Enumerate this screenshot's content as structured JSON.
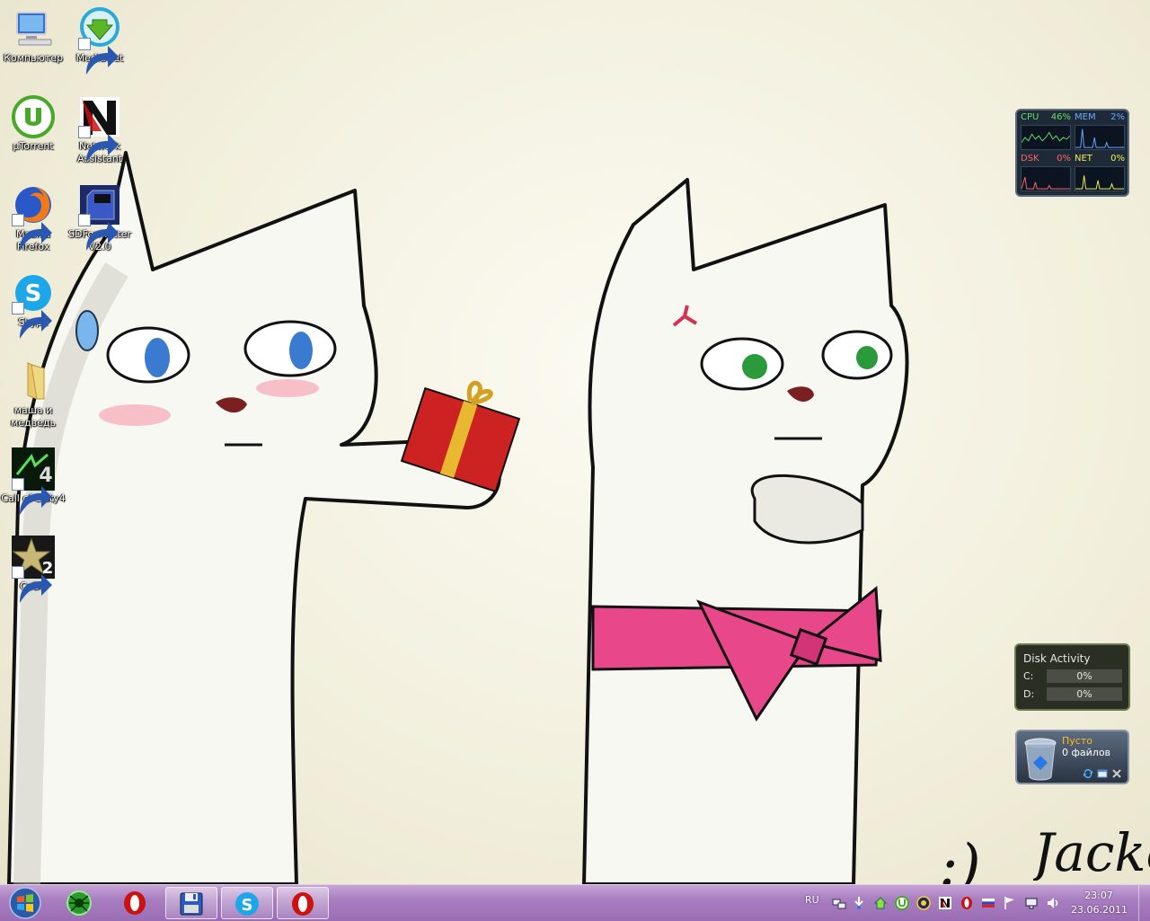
{
  "desktop": {
    "icons": [
      {
        "label": "Компьютер",
        "icon": "computer-icon"
      },
      {
        "label": "MediaGet",
        "icon": "mediaget-icon"
      },
      {
        "label": "µTorrent",
        "icon": "utorrent-icon"
      },
      {
        "label": "Network Assistant",
        "icon": "network-assistant-icon"
      },
      {
        "label": "Mozilla Firefox",
        "icon": "firefox-icon"
      },
      {
        "label": "SDFormatter V2.0",
        "icon": "sdformatter-icon"
      },
      {
        "label": "Skype",
        "icon": "skype-icon"
      },
      {
        "label": "маша и медведь",
        "icon": "folder-icon"
      },
      {
        "label": "Call of Duty4",
        "icon": "call-of-duty4-icon"
      },
      {
        "label": "CoD2",
        "icon": "cod2-icon"
      }
    ],
    "wallpaper_signature": "Jacke"
  },
  "cpu_meter": {
    "cpu": {
      "label": "CPU",
      "value": "46%",
      "color": "#66dd66"
    },
    "mem": {
      "label": "MEM",
      "value": "2%",
      "color": "#66aaff"
    },
    "dsk": {
      "label": "DSK",
      "value": "0%",
      "color": "#ff6666"
    },
    "net": {
      "label": "NET",
      "value": "0%",
      "color": "#eeee55"
    }
  },
  "disk_activity": {
    "title": "Disk Activity",
    "drives": [
      {
        "label": "C:",
        "value": "0%"
      },
      {
        "label": "D:",
        "value": "0%"
      }
    ]
  },
  "recycle_bin": {
    "status": "Пусто",
    "count": "0 файлов"
  },
  "taskbar": {
    "start_icon": "windows-start-icon",
    "buttons": [
      {
        "icon": "spider-app-icon"
      },
      {
        "icon": "opera-icon"
      },
      {
        "icon": "floppy-disk-icon"
      },
      {
        "icon": "skype-icon"
      },
      {
        "icon": "opera-icon"
      }
    ],
    "tray": {
      "language": "RU",
      "time": "23:07",
      "date": "23.06.2011"
    }
  },
  "colors": {
    "taskbar": "#a87ec0",
    "bow": "#e8488a",
    "gift": "#cc2222"
  }
}
